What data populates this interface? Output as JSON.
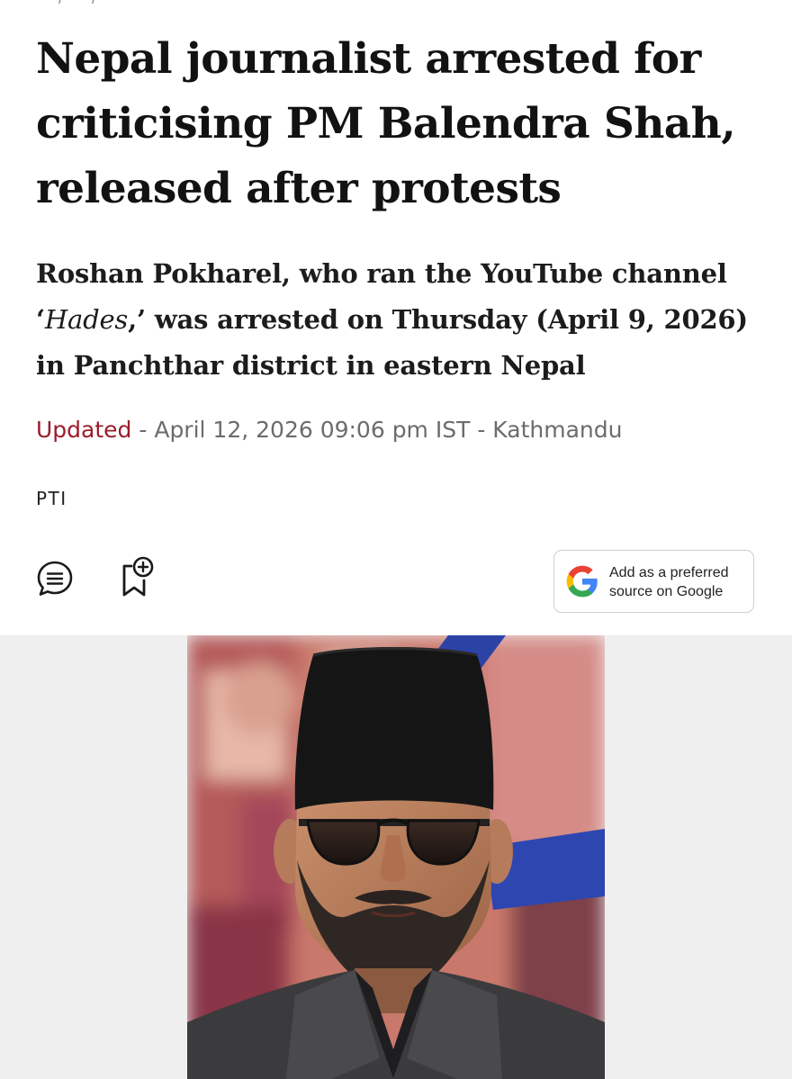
{
  "breadcrumb": "— / — / —",
  "article": {
    "headline": "Nepal journalist arrested for criticising PM Balendra Shah, released after protests",
    "summary_before": "Roshan Pokharel, who ran the YouTube channel ‘",
    "summary_italic": "Hades",
    "summary_after": ",’ was arrested on Thursday (April 9, 2026) in Panchthar district in eastern Nepal",
    "updated_label": "Updated",
    "updated_datetime": " - April 12, 2026 09:06 pm IST - ",
    "location": "Kathmandu",
    "byline": "PTI"
  },
  "actions": {
    "comment_icon": "comment-icon",
    "bookmark_icon": "bookmark-add-icon",
    "google_button_text": "Add as a preferred\nsource on Google",
    "google_icon": "google-g-icon"
  },
  "colors": {
    "accent_updated": "#9b1c2c",
    "meta_gray": "#6c6c6c",
    "photo_band": "#efefef",
    "google_blue": "#4285F4",
    "google_red": "#EA4335",
    "google_yellow": "#FBBC05",
    "google_green": "#34A853"
  }
}
